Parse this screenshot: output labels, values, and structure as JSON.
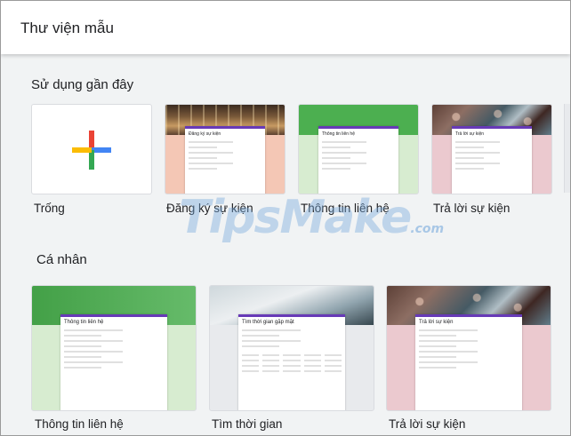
{
  "header": {
    "title": "Thư viện mẫu"
  },
  "sections": [
    {
      "title": "Sử dụng gần đây",
      "templates": [
        {
          "label": "Trống",
          "preview": "blank"
        },
        {
          "label": "Đăng ký sự kiện",
          "preview": "event-registration",
          "form_title": "Đăng ký sự kiện",
          "accent": "#f4c7b5"
        },
        {
          "label": "Thông tin liên hệ",
          "preview": "contact-info",
          "form_title": "Thông tin liên hệ",
          "accent": "#d7ecd0"
        },
        {
          "label": "Trả lời sự kiện",
          "preview": "event-rsvp",
          "form_title": "Trả lời sự kiện",
          "accent": "#ebc9cf"
        }
      ]
    },
    {
      "title": "Cá nhân",
      "templates": [
        {
          "label": "Thông tin liên hệ",
          "preview": "contact-info",
          "form_title": "Thông tin liên hệ",
          "accent": "#d7ecd0"
        },
        {
          "label": "Tìm thời gian",
          "preview": "find-time",
          "form_title": "Tìm thời gian gặp mặt",
          "accent": "#e8eaed"
        },
        {
          "label": "Trả lời sự kiện",
          "preview": "event-rsvp",
          "form_title": "Trả lời sự kiện",
          "accent": "#ebc9cf"
        }
      ]
    }
  ],
  "watermark": {
    "text": "TipsMake",
    "suffix": ".com"
  },
  "colors": {
    "google_red": "#ea4335",
    "google_blue": "#4285f4",
    "google_yellow": "#fbbc04",
    "google_green": "#34a853",
    "forms_purple": "#673ab7"
  }
}
